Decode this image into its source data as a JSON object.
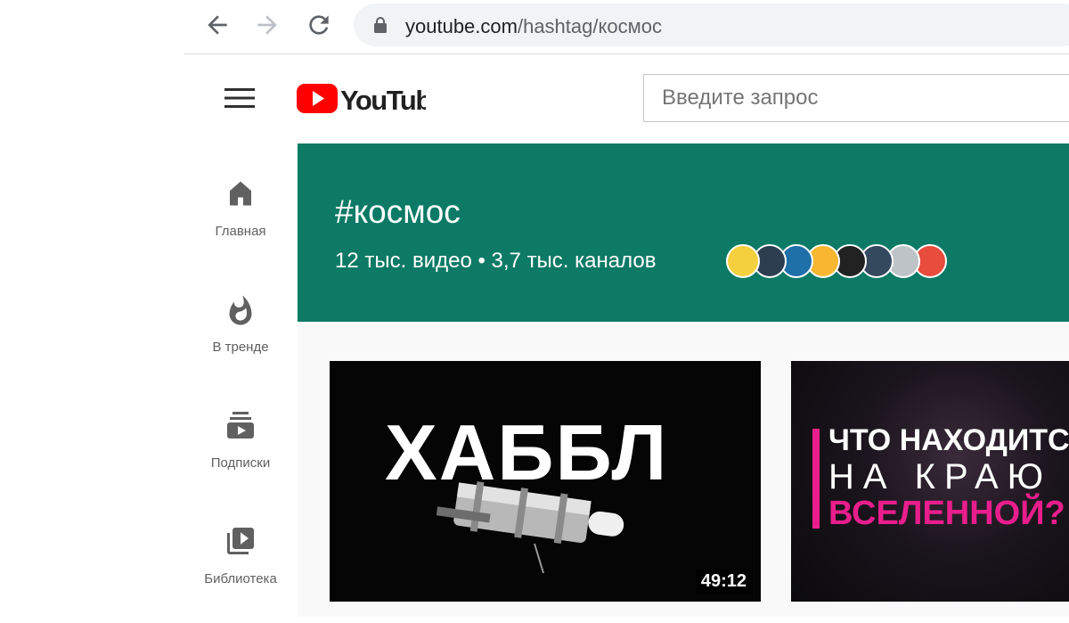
{
  "browser": {
    "url_host": "youtube.com",
    "url_path": "/hashtag/космос"
  },
  "masthead": {
    "logo_text": "YouTube",
    "search_placeholder": "Введите запрос"
  },
  "guide": {
    "items": [
      {
        "label": "Главная",
        "icon": "home-icon"
      },
      {
        "label": "В тренде",
        "icon": "trending-fire-icon"
      },
      {
        "label": "Подписки",
        "icon": "subscriptions-icon"
      },
      {
        "label": "Библиотека",
        "icon": "library-icon"
      }
    ]
  },
  "hashtag": {
    "title": "#космос",
    "stats": "12 тыс. видео • 3,7 тыс. каналов",
    "channel_avatar_colors": [
      "#f4d03f",
      "#2c3e50",
      "#1f6fa8",
      "#f7b731",
      "#222222",
      "#34495e",
      "#bdc3c7",
      "#e74c3c"
    ],
    "header_color": "#0d7a66"
  },
  "videos": [
    {
      "thumb_text": "ХАББЛ",
      "duration": "49:12"
    },
    {
      "thumb_lines": [
        "ЧТО НАХОДИТСЯ",
        "НА КРАЮ",
        "ВСЕЛЕННОЙ?"
      ],
      "accent": "#e91e8c"
    }
  ]
}
